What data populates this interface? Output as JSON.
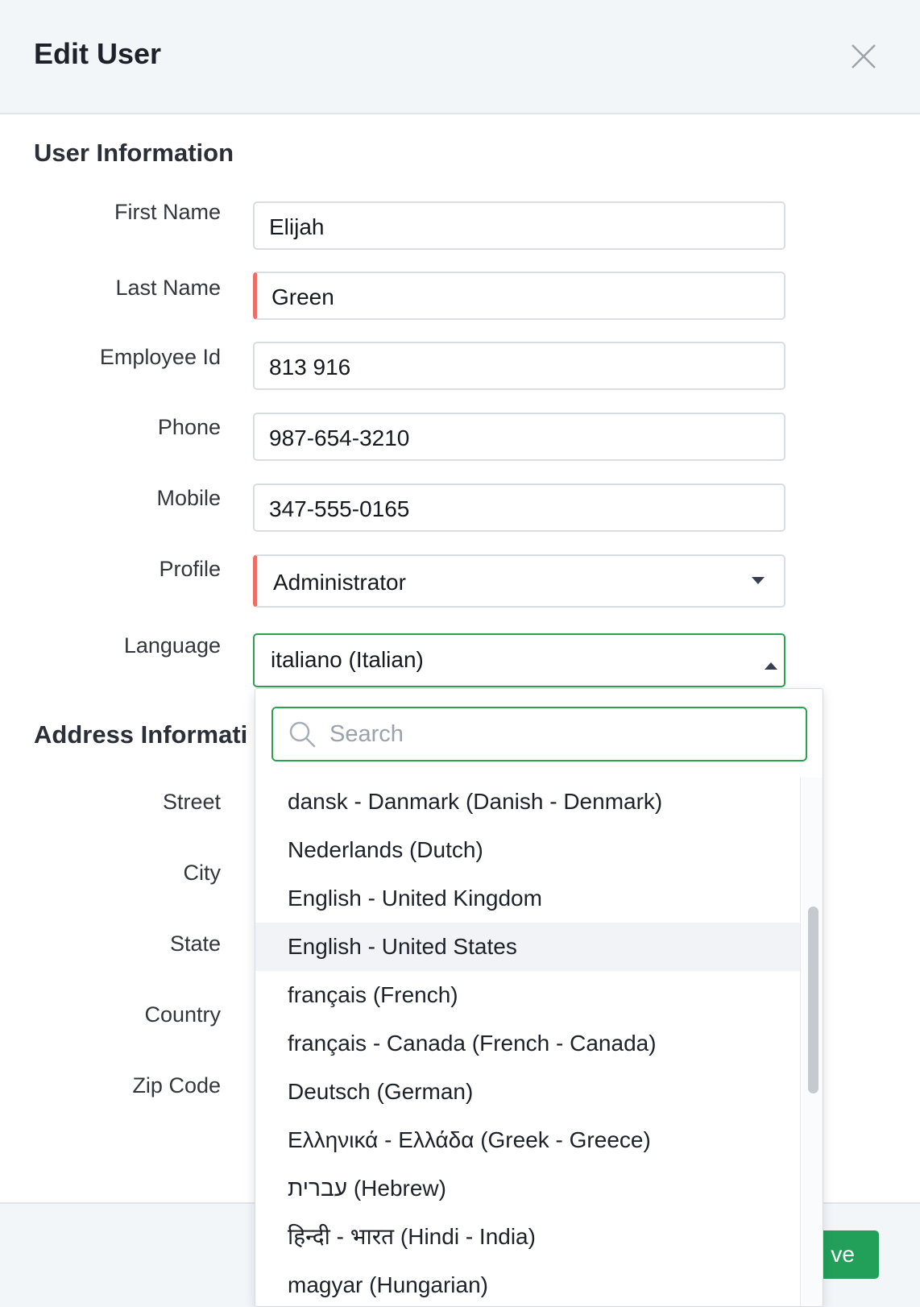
{
  "modal": {
    "title": "Edit User"
  },
  "sections": {
    "user_info": "User Information",
    "address_info": "Address Informati"
  },
  "fields": {
    "first_name": {
      "label": "First Name",
      "value": "Elijah"
    },
    "last_name": {
      "label": "Last Name",
      "value": "Green"
    },
    "employee_id": {
      "label": "Employee Id",
      "value": "813 916"
    },
    "phone": {
      "label": "Phone",
      "value": "987-654-3210"
    },
    "mobile": {
      "label": "Mobile",
      "value": "347-555-0165"
    },
    "profile": {
      "label": "Profile",
      "value": "Administrator"
    },
    "language": {
      "label": "Language",
      "value": "italiano (Italian)"
    }
  },
  "address_labels": {
    "street": "Street",
    "city": "City",
    "state": "State",
    "country": "Country",
    "zip": "Zip Code"
  },
  "dropdown": {
    "search_placeholder": "Search",
    "options": [
      "dansk - Danmark (Danish - Denmark)",
      "Nederlands (Dutch)",
      "English - United Kingdom",
      "English - United States",
      "français (French)",
      "français - Canada (French - Canada)",
      "Deutsch (German)",
      "Ελληνικά - Ελλάδα (Greek - Greece)",
      "עברית (Hebrew)",
      "हिन्दी - भारत (Hindi - India)",
      "magyar (Hungarian)"
    ],
    "hovered_index": 3
  },
  "footer": {
    "save_label": "ve"
  }
}
